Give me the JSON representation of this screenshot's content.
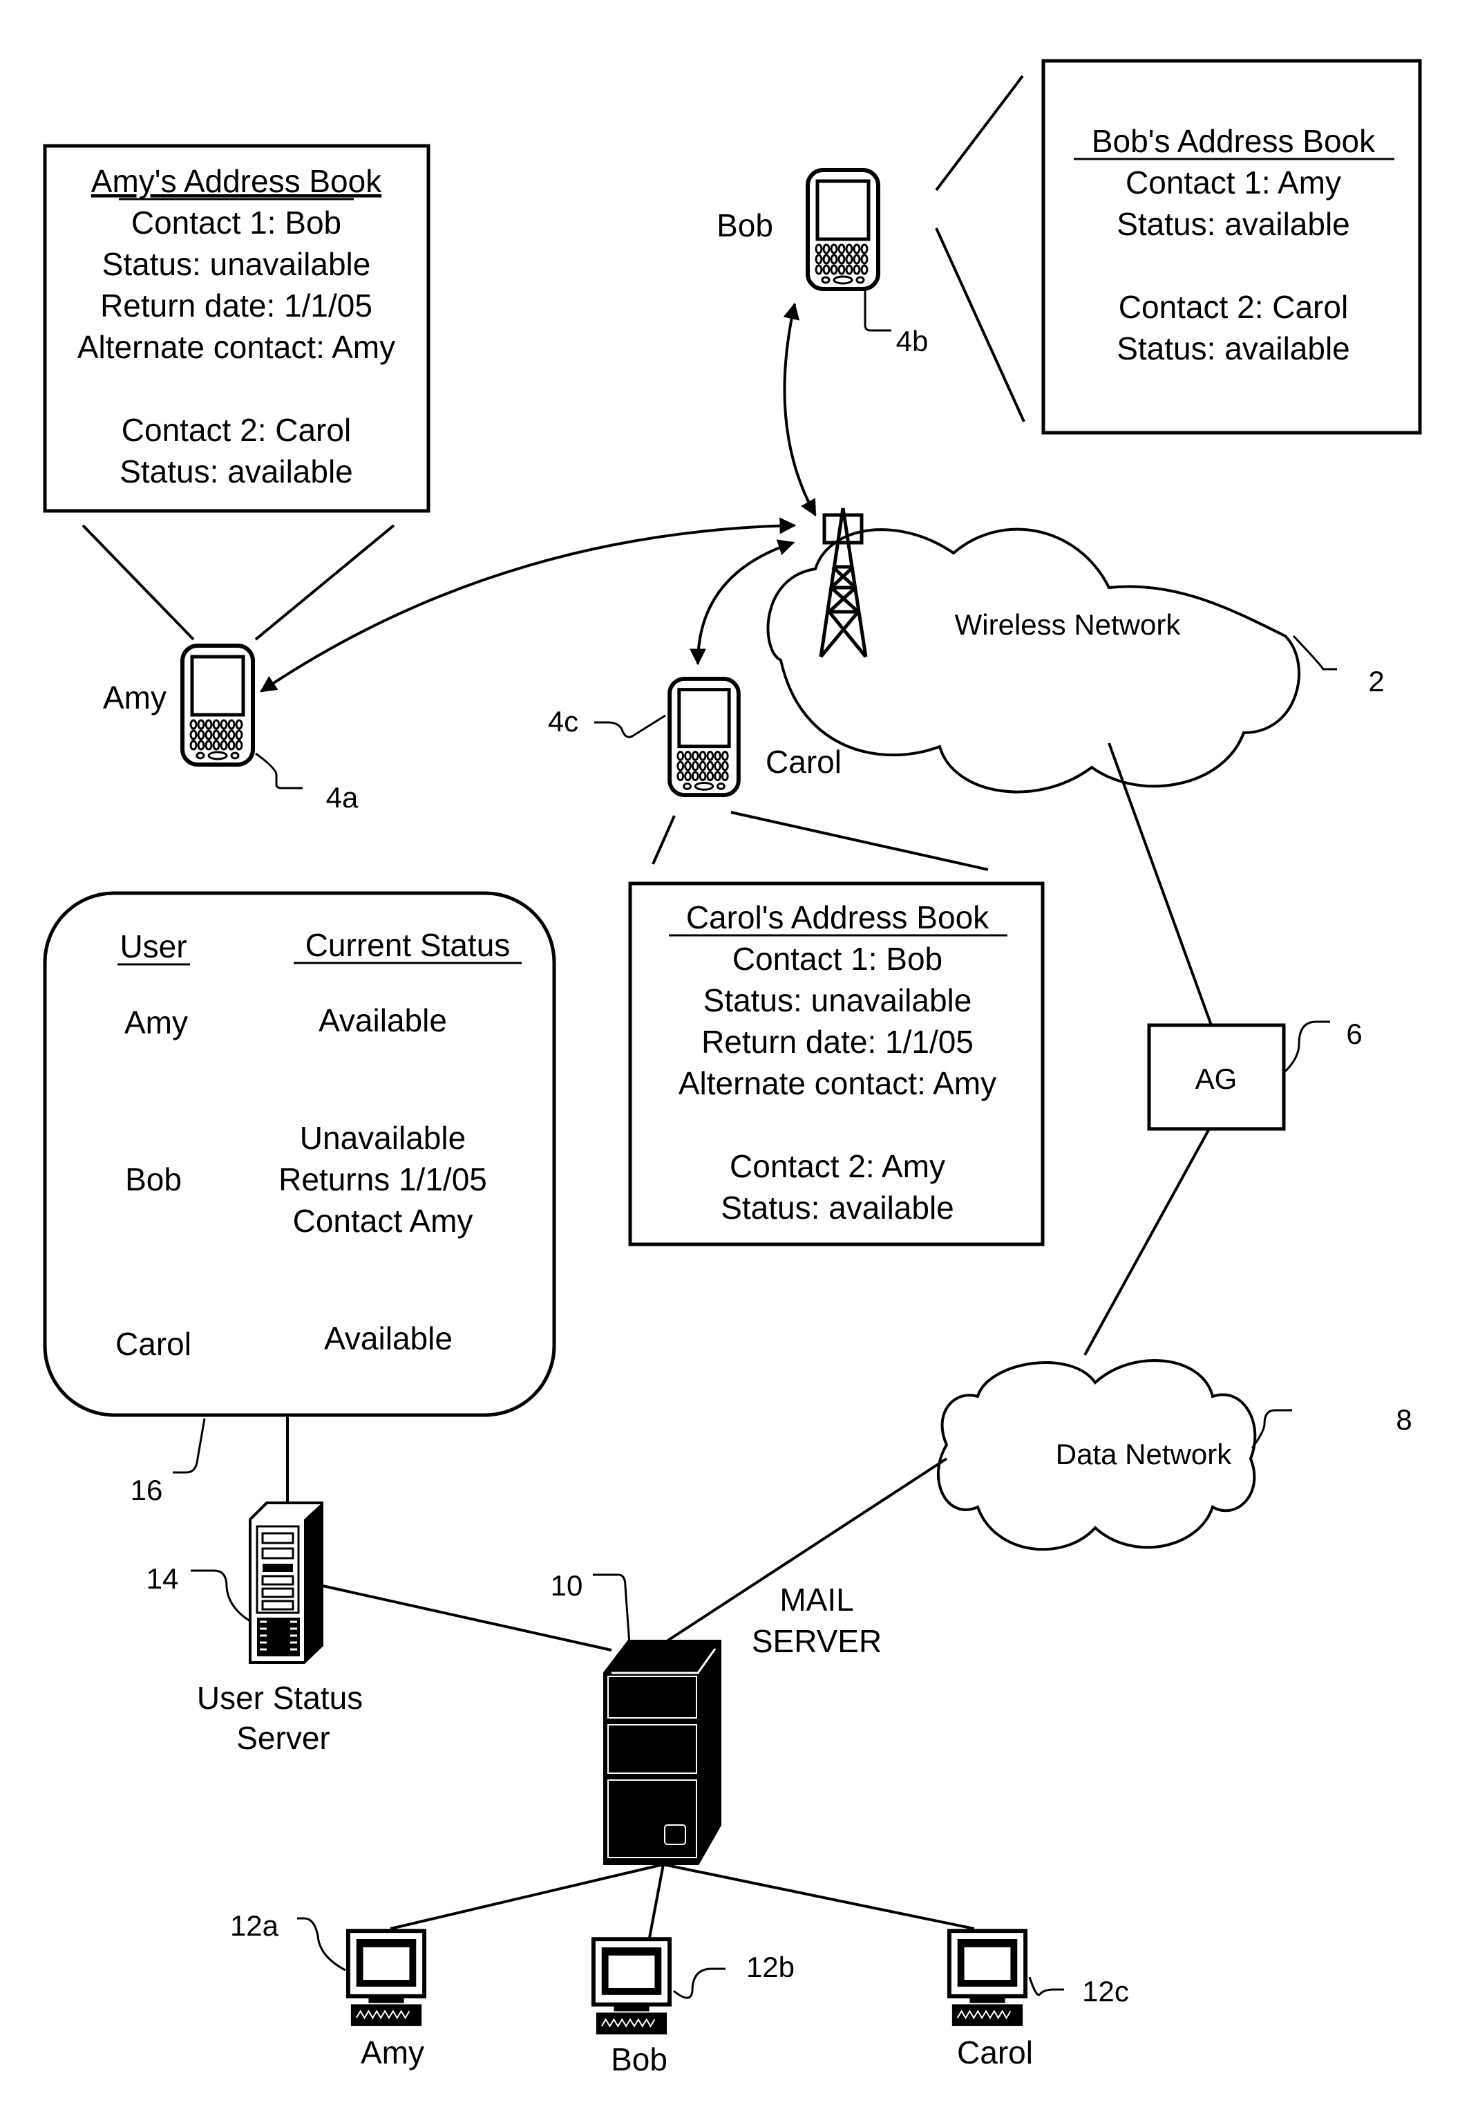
{
  "figure": {
    "address_books": {
      "amy": {
        "title": "Amy's Address Book",
        "lines": [
          "Contact 1: Bob",
          "Status: unavailable",
          "Return date: 1/1/05",
          "Alternate contact: Amy",
          "",
          "Contact 2: Carol",
          "Status: available"
        ]
      },
      "bob": {
        "title": "Bob's Address Book",
        "lines": [
          "Contact 1: Amy",
          "Status: available",
          "",
          "Contact 2: Carol",
          "Status: available"
        ]
      },
      "carol": {
        "title": "Carol's Address Book",
        "lines": [
          "Contact 1: Bob",
          "Status: unavailable",
          "Return date: 1/1/05",
          "Alternate contact: Amy",
          "",
          "Contact 2: Amy",
          "Status: available"
        ]
      }
    },
    "devices": {
      "amy_phone": {
        "name": "Amy",
        "ref": "4a"
      },
      "bob_phone": {
        "name": "Bob",
        "ref": "4b"
      },
      "carol_phone": {
        "name": "Carol",
        "ref": "4c"
      }
    },
    "networks": {
      "wireless": {
        "label": "Wireless Network",
        "ref": "2"
      },
      "data": {
        "label": "Data Network",
        "ref": "8"
      }
    },
    "gateway": {
      "label": "AG",
      "ref": "6"
    },
    "status_table": {
      "ref": "16",
      "headers": [
        "User",
        "Current Status"
      ],
      "rows": [
        {
          "user": "Amy",
          "status": [
            "Available"
          ]
        },
        {
          "user": "Bob",
          "status": [
            "Unavailable",
            "Returns 1/1/05",
            "Contact Amy"
          ]
        },
        {
          "user": "Carol",
          "status": [
            "Available"
          ]
        }
      ]
    },
    "user_status_server": {
      "label_lines": [
        "User Status",
        "Server"
      ],
      "ref": "14"
    },
    "mail_server": {
      "label_lines": [
        "MAIL",
        "SERVER"
      ],
      "ref": "10"
    },
    "computers": [
      {
        "name": "Amy",
        "ref": "12a"
      },
      {
        "name": "Bob",
        "ref": "12b"
      },
      {
        "name": "Carol",
        "ref": "12c"
      }
    ]
  }
}
